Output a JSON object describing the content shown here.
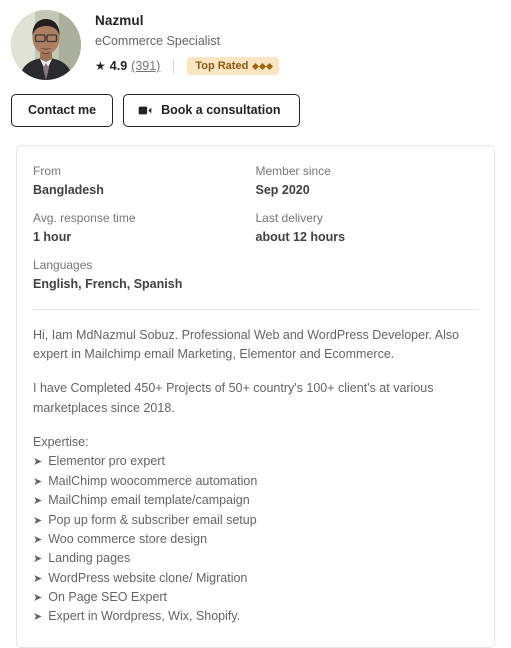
{
  "profile": {
    "avatar_alt": "seller-avatar-photo",
    "name": "Nazmul",
    "role": "eCommerce Specialist",
    "rating": {
      "star_icon": "star-icon",
      "score": "4.9",
      "count": "(391)"
    },
    "badge": {
      "label": "Top Rated",
      "diamond_count": 3,
      "bg_color": "#fbe5c3",
      "text_color": "#8b5a10"
    }
  },
  "actions": {
    "contact_label": "Contact me",
    "consult_label": "Book a consultation",
    "consult_icon": "video-camera-icon"
  },
  "info_card": {
    "stats": [
      {
        "label": "From",
        "value": "Bangladesh"
      },
      {
        "label": "Member since",
        "value": "Sep 2020"
      },
      {
        "label": "Avg. response time",
        "value": "1 hour"
      },
      {
        "label": "Last delivery",
        "value": "about 12 hours"
      },
      {
        "label": "Languages",
        "value": "English, French, Spanish"
      }
    ],
    "description": [
      "Hi, Iam MdNazmul Sobuz. Professional Web and WordPress Developer. Also expert in Mailchimp email Marketing, Elementor and Ecommerce.",
      "I have Completed 450+ Projects of 50+ country's 100+ client's at various marketplaces since 2018."
    ],
    "expertise_title": "Expertise:",
    "expertise_bullet": "➤",
    "expertise_items": [
      "Elementor pro expert",
      "MailChimp woocommerce automation",
      "MailChimp email template/campaign",
      "Pop up form & subscriber email setup",
      "Woo commerce store design",
      "Landing pages",
      "WordPress website clone/ Migration",
      "On Page SEO Expert",
      "Expert in Wordpress, Wix, Shopify."
    ]
  }
}
